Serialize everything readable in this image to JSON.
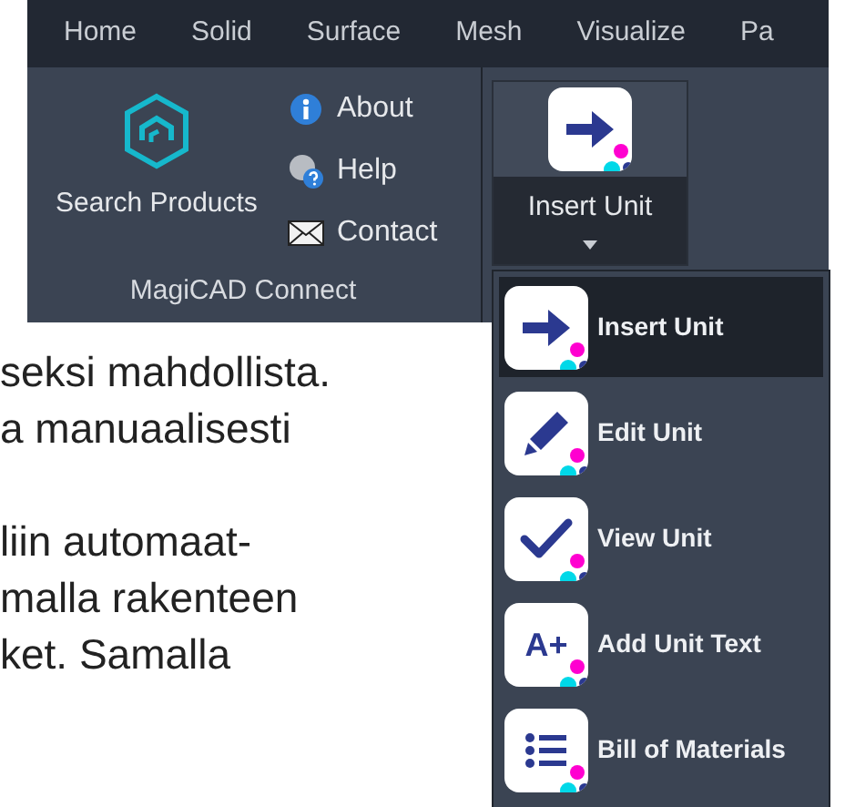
{
  "tabs": [
    {
      "label": "Home"
    },
    {
      "label": "Solid"
    },
    {
      "label": "Surface"
    },
    {
      "label": "Mesh"
    },
    {
      "label": "Visualize"
    },
    {
      "label": "Pa"
    }
  ],
  "connect_group": {
    "search_button": "Search Products",
    "links": [
      {
        "kind": "info",
        "label": "About"
      },
      {
        "kind": "help",
        "label": "Help"
      },
      {
        "kind": "mail",
        "label": "Contact"
      }
    ],
    "title": "MagiCAD Connect"
  },
  "insert_button": {
    "label": "Insert Unit",
    "expanded": true
  },
  "menu": [
    {
      "kind": "arrow",
      "label": "Insert Unit",
      "selected": true
    },
    {
      "kind": "pencil",
      "label": "Edit Unit",
      "selected": false
    },
    {
      "kind": "check",
      "label": "View Unit",
      "selected": false
    },
    {
      "kind": "letters",
      "glyph": "A+",
      "label": "Add Unit Text",
      "selected": false
    },
    {
      "kind": "list",
      "label": "Bill of Materials",
      "selected": false
    }
  ],
  "article_paragraphs": [
    [
      "seksi mahdollista.",
      "a manuaalisesti"
    ],
    [
      "liin automaat-",
      "malla rakenteen",
      "ket. Samalla"
    ]
  ]
}
